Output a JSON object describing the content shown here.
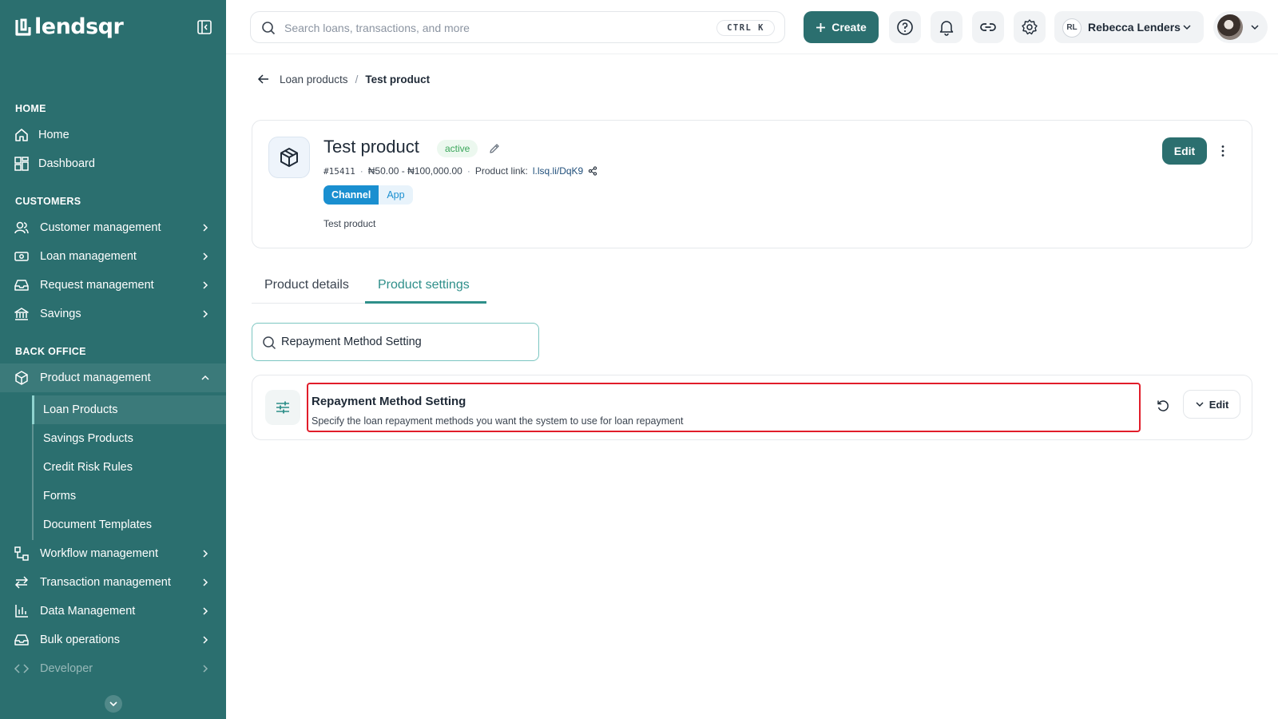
{
  "app": {
    "logo_text": "lendsqr"
  },
  "sidebar": {
    "sections": {
      "home": "HOME",
      "customers": "CUSTOMERS",
      "back_office": "BACK OFFICE"
    },
    "home_items": [
      {
        "label": "Home",
        "icon": "home-icon"
      },
      {
        "label": "Dashboard",
        "icon": "dashboard-icon"
      }
    ],
    "customer_items": [
      {
        "label": "Customer management",
        "icon": "users-icon"
      },
      {
        "label": "Loan management",
        "icon": "cash-icon"
      },
      {
        "label": "Request management",
        "icon": "inbox-icon"
      },
      {
        "label": "Savings",
        "icon": "bank-icon"
      }
    ],
    "back_office_items": {
      "product_management": "Product management",
      "sub": [
        "Loan Products",
        "Savings Products",
        "Credit Risk Rules",
        "Forms",
        "Document Templates"
      ],
      "rest": [
        {
          "label": "Workflow management",
          "icon": "workflow-icon"
        },
        {
          "label": "Transaction management",
          "icon": "transfer-icon"
        },
        {
          "label": "Data Management",
          "icon": "bar-chart-icon"
        },
        {
          "label": "Bulk operations",
          "icon": "inbox-stack-icon"
        },
        {
          "label": "Developer",
          "icon": "code-icon"
        }
      ]
    },
    "colors": {
      "bg": "#2b6f6f"
    }
  },
  "topbar": {
    "search_placeholder": "Search loans, transactions, and more",
    "shortcut": "CTRL K",
    "create_label": "Create",
    "org": {
      "initials": "RL",
      "name": "Rebecca Lenders"
    }
  },
  "breadcrumb": {
    "parent": "Loan products",
    "separator": "/",
    "current": "Test product"
  },
  "product": {
    "title": "Test product",
    "status": "active",
    "code": "#15411",
    "range": "₦50.00 - ₦100,000.00",
    "link_label": "Product link:",
    "link": "l.lsq.li/DqK9",
    "chip_label": "Channel",
    "chip_value": "App",
    "description": "Test product",
    "edit_label": "Edit"
  },
  "tabs": [
    {
      "label": "Product details",
      "active": false
    },
    {
      "label": "Product settings",
      "active": true
    }
  ],
  "filter": {
    "value": "Repayment Method Setting"
  },
  "setting": {
    "title": "Repayment Method Setting",
    "description": "Specify the loan repayment methods you want the system to use for loan repayment",
    "edit_label": "Edit"
  },
  "colors": {
    "accent": "#2b6f6f",
    "tab_active": "#2e8f8a",
    "highlight": "#e11d2a",
    "status_green": "#3aa65a",
    "chip_blue": "#1a8fd0"
  }
}
